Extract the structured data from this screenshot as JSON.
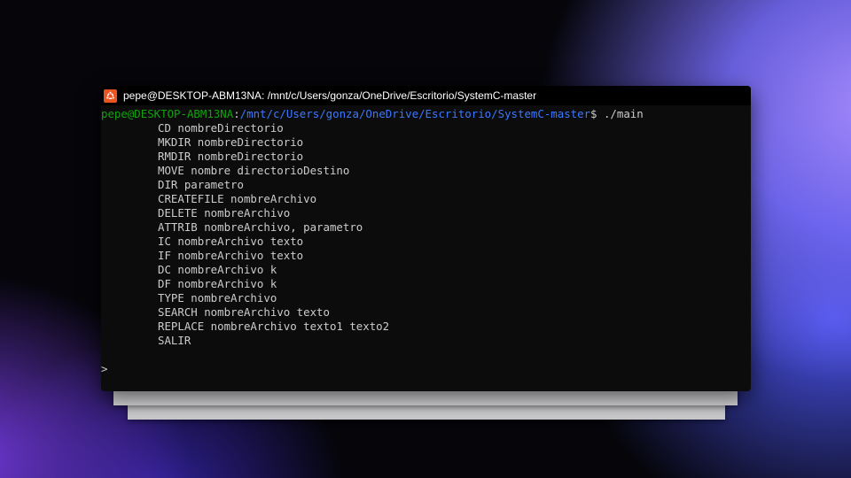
{
  "window": {
    "title": "pepe@DESKTOP-ABM13NA: /mnt/c/Users/gonza/OneDrive/Escritorio/SystemC-master",
    "icon": "ubuntu-icon"
  },
  "prompt": {
    "user_host": "pepe@DESKTOP-ABM13NA",
    "separator": ":",
    "path": "/mnt/c/Users/gonza/OneDrive/Escritorio/SystemC-master",
    "symbol": "$ ",
    "command": "./main"
  },
  "output": [
    "CD nombreDirectorio",
    "MKDIR nombreDirectorio",
    "RMDIR nombreDirectorio",
    "MOVE nombre directorioDestino",
    "DIR parametro",
    "CREATEFILE nombreArchivo",
    "DELETE nombreArchivo",
    "ATTRIB nombreArchivo, parametro",
    "IC nombreArchivo texto",
    "IF nombreArchivo texto",
    "DC nombreArchivo k",
    "DF nombreArchivo k",
    "TYPE nombreArchivo",
    "SEARCH nombreArchivo texto",
    "REPLACE nombreArchivo texto1 texto2",
    "SALIR"
  ],
  "input_prompt": ">",
  "colors": {
    "user_host": "#13a10e",
    "path": "#3b78ff",
    "text": "#cccccc",
    "background": "#0c0c0c",
    "icon": "#e95420"
  }
}
